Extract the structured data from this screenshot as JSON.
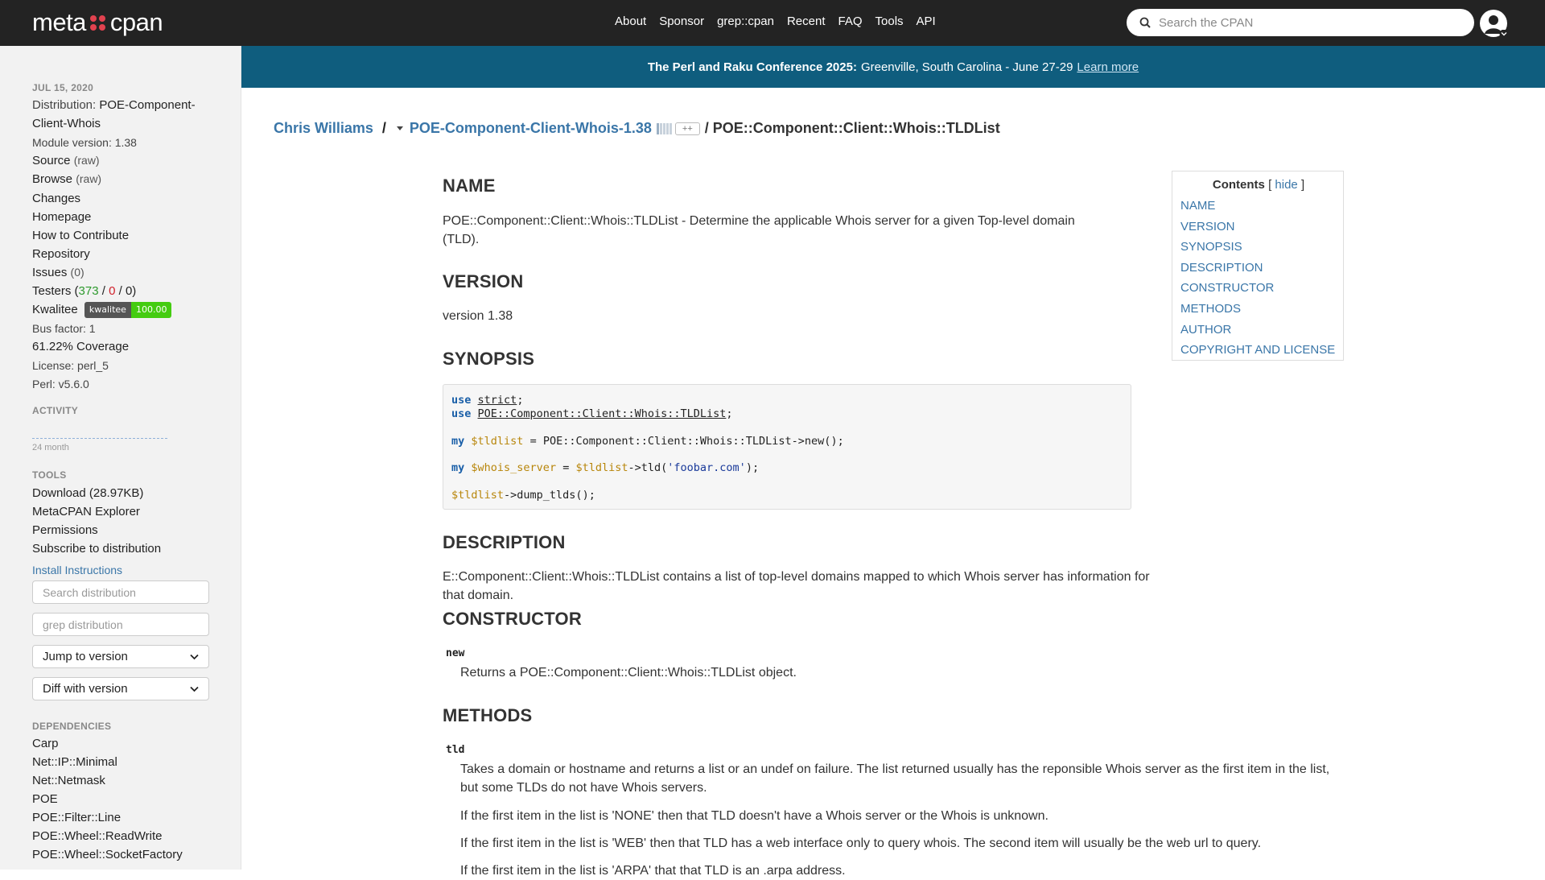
{
  "topbar": {
    "logo_left": "meta",
    "logo_right": "cpan",
    "nav": [
      "About",
      "Sponsor",
      "grep::cpan",
      "Recent",
      "FAQ",
      "Tools",
      "API"
    ],
    "search_placeholder": "Search the CPAN"
  },
  "banner": {
    "title": "The Perl and Raku Conference 2025:",
    "text": "Greenville, South Carolina - June 27-29",
    "link": "Learn more"
  },
  "breadcrumb": {
    "author": "Chris Williams",
    "sep1": "/",
    "distribution": "POE-Component-Client-Whois-1.38",
    "plusplus": "++",
    "module": "/ POE::Component::Client::Whois::TLDList"
  },
  "sidebar": {
    "date": "JUL 15, 2020",
    "distribution_label": "Distribution:",
    "distribution_name_1": "POE-Component-",
    "distribution_name_2": "Client-Whois",
    "module_version": "Module version: 1.38",
    "source": "Source",
    "source_raw": "(raw)",
    "browse": "Browse",
    "browse_raw": "(raw)",
    "changes": "Changes",
    "homepage": "Homepage",
    "contribute": "How to Contribute",
    "repository": "Repository",
    "issues": "Issues",
    "issues_count": "(0)",
    "testers": "Testers",
    "testers_pass": "373",
    "testers_fail": "0",
    "testers_other": "0",
    "kwalitee": "Kwalitee",
    "kwalitee_badge_label": "kwalitee",
    "kwalitee_badge_value": "100.00",
    "bus_factor": "Bus factor: 1",
    "coverage": "61.22% Coverage",
    "license": "License: perl_5",
    "perl": "Perl: v5.6.0",
    "activity_head": "ACTIVITY",
    "activity_period": "24 month",
    "tools_head": "TOOLS",
    "download": "Download (28.97KB)",
    "explorer": "MetaCPAN Explorer",
    "permissions": "Permissions",
    "subscribe": "Subscribe to distribution",
    "install": "Install Instructions",
    "search_dist_placeholder": "Search distribution",
    "grep_dist_placeholder": "grep distribution",
    "jump_version": "Jump to version",
    "diff_version": "Diff with version",
    "deps_head": "DEPENDENCIES",
    "deps": [
      "Carp",
      "Net::IP::Minimal",
      "Net::Netmask",
      "POE",
      "POE::Filter::Line",
      "POE::Wheel::ReadWrite",
      "POE::Wheel::SocketFactory"
    ]
  },
  "toc": {
    "title": "Contents",
    "open_bracket": "[",
    "hide": "hide",
    "close_bracket": "]",
    "items": [
      "NAME",
      "VERSION",
      "SYNOPSIS",
      "DESCRIPTION",
      "CONSTRUCTOR",
      "METHODS",
      "AUTHOR",
      "COPYRIGHT AND LICENSE"
    ]
  },
  "content": {
    "name_head": "NAME",
    "name_text": "POE::Component::Client::Whois::TLDList - Determine the applicable Whois server for a given Top-level domain (TLD).",
    "version_head": "VERSION",
    "version_text": "version 1.38",
    "synopsis_head": "SYNOPSIS",
    "code": {
      "use1_kw": "use",
      "use1_mod": "strict",
      "use2_kw": "use",
      "use2_mod": "POE::Component::Client::Whois::TLDList",
      "l3_kw": "my",
      "l3_var": "$tldlist",
      "l3_rest": " = POE::Component::Client::Whois::TLDList->new();",
      "l4_kw": "my",
      "l4_var": "$whois_server",
      "l4_eq": " = ",
      "l4_var2": "$tldlist",
      "l4_mid": "->tld(",
      "l4_str": "'foobar.com'",
      "l4_end": ");",
      "l5_var": "$tldlist",
      "l5_rest": "->dump_tlds();"
    },
    "description_head": "DESCRIPTION",
    "description_text": "E::Component::Client::Whois::TLDList contains a list of top-level domains mapped to which Whois server has information for that domain.",
    "constructor_head": "CONSTRUCTOR",
    "new_term": "new",
    "new_text": "Returns a POE::Component::Client::Whois::TLDList object.",
    "methods_head": "METHODS",
    "tld_term": "tld",
    "tld_text1": "Takes a domain or hostname and returns a list or an undef on failure. The list returned usually has the reponsible Whois server as the first item in the list, but some TLDs do not have Whois servers.",
    "tld_text2": "If the first item in the list is 'NONE' then that TLD doesn't have a Whois server or the Whois is unknown.",
    "tld_text3": "If the first item in the list is 'WEB' then that TLD has a web interface only to query whois. The second item will usually be the web url to query.",
    "tld_text4": "If the first item in the list is 'ARPA' that that TLD is an .arpa address."
  }
}
